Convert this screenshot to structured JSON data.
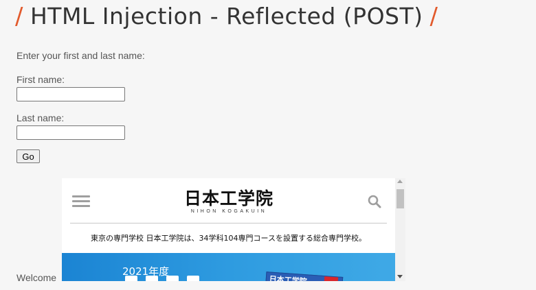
{
  "title": {
    "slash_left": "/",
    "text": "HTML Injection - Reflected (POST)",
    "slash_right": "/"
  },
  "form": {
    "intro": "Enter your first and last name:",
    "first_label": "First name:",
    "first_value": "",
    "last_label": "Last name:",
    "last_value": "",
    "go_label": "Go"
  },
  "welcome": "Welcome",
  "embedded_site": {
    "logo_main": "日本工学院",
    "logo_sub": "NIHON KOGAKUIN",
    "tagline": "東京の専門学校 日本工学院は、34学科104専門コースを設置する総合専門学校。",
    "banner_year": "2021年度",
    "book_label": "日本工学院"
  },
  "colors": {
    "accent": "#e25a2c",
    "banner": "#1b84d3"
  },
  "icons": [
    "hamburger-menu-icon",
    "search-icon",
    "scroll-up-icon",
    "scroll-down-icon"
  ]
}
